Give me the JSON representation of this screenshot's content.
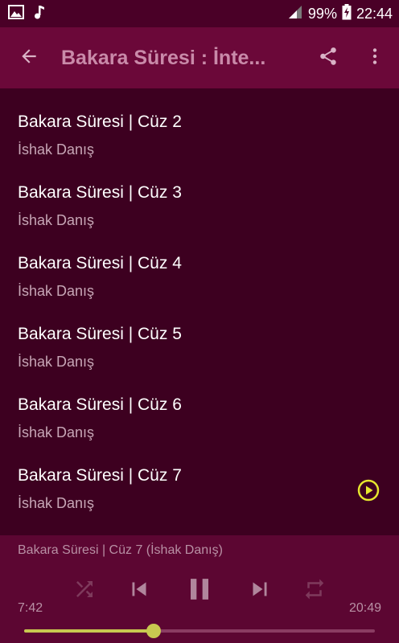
{
  "status_bar": {
    "battery": "99%",
    "time": "22:44"
  },
  "toolbar": {
    "title": "Bakara Süresi : İnte..."
  },
  "list": {
    "items": [
      {
        "title": "Bakara Süresi | Cüz 2",
        "subtitle": "İshak Danış",
        "playing": false
      },
      {
        "title": "Bakara Süresi | Cüz 3",
        "subtitle": "İshak Danış",
        "playing": false
      },
      {
        "title": "Bakara Süresi | Cüz 4",
        "subtitle": "İshak Danış",
        "playing": false
      },
      {
        "title": "Bakara Süresi | Cüz 5",
        "subtitle": "İshak Danış",
        "playing": false
      },
      {
        "title": "Bakara Süresi | Cüz 6",
        "subtitle": "İshak Danış",
        "playing": false
      },
      {
        "title": "Bakara Süresi | Cüz 7",
        "subtitle": "İshak Danış",
        "playing": true
      }
    ]
  },
  "player": {
    "now_playing": "Bakara Süresi | Cüz 7 (İshak Danış)",
    "elapsed": "7:42",
    "duration": "20:49",
    "progress": 0.37,
    "state": "playing"
  },
  "icons": {
    "status_left": [
      "image-icon",
      "music-note-icon"
    ],
    "status_right": [
      "signal-icon",
      "battery-charging-icon"
    ],
    "toolbar": [
      "back-arrow-icon",
      "share-icon",
      "more-vert-icon"
    ],
    "controls": [
      "shuffle-icon",
      "skip-previous-icon",
      "pause-icon",
      "skip-next-icon",
      "repeat-icon"
    ],
    "list": [
      "play-circle-icon"
    ]
  },
  "colors": {
    "status_bar": "#4a0027",
    "toolbar": "#6b0839",
    "list_background": "#3d0020",
    "player_background": "#5c0632",
    "accent": "#e6e62e",
    "seek_accent": "#c8c850"
  }
}
